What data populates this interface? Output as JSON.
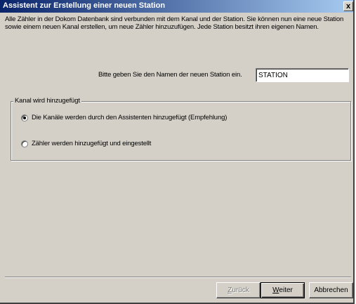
{
  "window": {
    "title": "Assistent zur Erstellung einer neuen Station",
    "close_label": "x"
  },
  "intro": {
    "text": "Alle Zähler in der Dokom  Datenbank sind verbunden mit dem Kanal und der Station. Sie können nun eine neue Station sowie einem neuen Kanal erstellen, um neue Zähler hinzuzufügen. Jede Station besitzt ihren eigenen Namen."
  },
  "station": {
    "label": "Bitte geben Sie den Namen der neuen Station ein.",
    "value": "STATION"
  },
  "channel_group": {
    "legend": "Kanal wird hinzugefügt",
    "options": [
      {
        "label": "Die Kanäle werden durch den Assistenten hinzugefügt (Empfehlung)",
        "checked": true
      },
      {
        "label": "Zähler werden hinzugefügt und eingestellt",
        "checked": false
      }
    ]
  },
  "buttons": {
    "back_first": "Z",
    "back_rest": "urück",
    "next_first": "W",
    "next_rest": "eiter",
    "cancel": "Abbrechen"
  }
}
